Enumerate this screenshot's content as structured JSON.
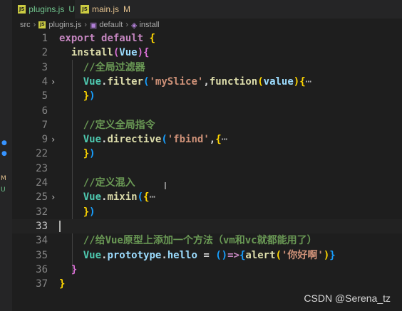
{
  "tabs": [
    {
      "name": "plugins.js",
      "status": "U",
      "active": true
    },
    {
      "name": "main.js",
      "status": "M",
      "active": false
    }
  ],
  "breadcrumb": {
    "folder": "src",
    "file": "plugins.js",
    "symbol1": "default",
    "symbol2": "install"
  },
  "activity_marks": {
    "m": "M",
    "u": "U"
  },
  "lines": [
    {
      "num": "1",
      "fold": "",
      "tokens": [
        {
          "t": "export ",
          "c": "kw"
        },
        {
          "t": "default ",
          "c": "kw"
        },
        {
          "t": "{",
          "c": "br1"
        }
      ]
    },
    {
      "num": "2",
      "fold": "",
      "tokens": [
        {
          "t": "  install",
          "c": "fn"
        },
        {
          "t": "(",
          "c": "br2"
        },
        {
          "t": "Vue",
          "c": "prop"
        },
        {
          "t": ")",
          "c": "br2"
        },
        {
          "t": "{",
          "c": "br2"
        }
      ]
    },
    {
      "num": "3",
      "fold": "",
      "tokens": [
        {
          "t": "    //全局过滤器",
          "c": "cm"
        }
      ]
    },
    {
      "num": "4",
      "fold": "›",
      "tokens": [
        {
          "t": "    Vue",
          "c": "cls"
        },
        {
          "t": ".",
          "c": "par"
        },
        {
          "t": "filter",
          "c": "fn"
        },
        {
          "t": "(",
          "c": "br3"
        },
        {
          "t": "'mySlice'",
          "c": "str"
        },
        {
          "t": ",",
          "c": "par"
        },
        {
          "t": "function",
          "c": "fn"
        },
        {
          "t": "(",
          "c": "br1"
        },
        {
          "t": "value",
          "c": "prop"
        },
        {
          "t": ")",
          "c": "br1"
        },
        {
          "t": "{",
          "c": "br1"
        },
        {
          "t": "⋯",
          "c": "ell"
        }
      ]
    },
    {
      "num": "5",
      "fold": "",
      "tokens": [
        {
          "t": "    }",
          "c": "br1"
        },
        {
          "t": ")",
          "c": "br3"
        }
      ]
    },
    {
      "num": "6",
      "fold": "",
      "tokens": []
    },
    {
      "num": "7",
      "fold": "",
      "tokens": [
        {
          "t": "    //定义全局指令",
          "c": "cm"
        }
      ]
    },
    {
      "num": "9",
      "fold": "›",
      "tokens": [
        {
          "t": "    Vue",
          "c": "cls"
        },
        {
          "t": ".",
          "c": "par"
        },
        {
          "t": "directive",
          "c": "fn"
        },
        {
          "t": "(",
          "c": "br3"
        },
        {
          "t": "'fbind'",
          "c": "str"
        },
        {
          "t": ",",
          "c": "par"
        },
        {
          "t": "{",
          "c": "br1"
        },
        {
          "t": "⋯",
          "c": "ell"
        }
      ]
    },
    {
      "num": "22",
      "fold": "",
      "tokens": [
        {
          "t": "    }",
          "c": "br1"
        },
        {
          "t": ")",
          "c": "br3"
        }
      ]
    },
    {
      "num": "23",
      "fold": "",
      "tokens": []
    },
    {
      "num": "24",
      "fold": "",
      "tokens": [
        {
          "t": "    //定义混入",
          "c": "cm"
        }
      ]
    },
    {
      "num": "25",
      "fold": "›",
      "tokens": [
        {
          "t": "    Vue",
          "c": "cls"
        },
        {
          "t": ".",
          "c": "par"
        },
        {
          "t": "mixin",
          "c": "fn"
        },
        {
          "t": "(",
          "c": "br3"
        },
        {
          "t": "{",
          "c": "br1"
        },
        {
          "t": "⋯",
          "c": "ell"
        }
      ]
    },
    {
      "num": "32",
      "fold": "",
      "tokens": [
        {
          "t": "    }",
          "c": "br1"
        },
        {
          "t": ")",
          "c": "br3"
        }
      ]
    },
    {
      "num": "33",
      "fold": "",
      "current": true,
      "tokens": []
    },
    {
      "num": "34",
      "fold": "",
      "tokens": [
        {
          "t": "    //给Vue原型上添加一个方法（vm和vc就都能用了）",
          "c": "cm"
        }
      ]
    },
    {
      "num": "35",
      "fold": "",
      "tokens": [
        {
          "t": "    Vue",
          "c": "cls"
        },
        {
          "t": ".",
          "c": "par"
        },
        {
          "t": "prototype",
          "c": "prop"
        },
        {
          "t": ".",
          "c": "par"
        },
        {
          "t": "hello",
          "c": "prop"
        },
        {
          "t": " = ",
          "c": "par"
        },
        {
          "t": "(",
          "c": "br3"
        },
        {
          "t": ")",
          "c": "br3"
        },
        {
          "t": "=>",
          "c": "kw"
        },
        {
          "t": "{",
          "c": "br3"
        },
        {
          "t": "alert",
          "c": "fn"
        },
        {
          "t": "(",
          "c": "br1"
        },
        {
          "t": "'你好啊'",
          "c": "str"
        },
        {
          "t": ")",
          "c": "br1"
        },
        {
          "t": "}",
          "c": "br3"
        }
      ]
    },
    {
      "num": "36",
      "fold": "",
      "tokens": [
        {
          "t": "  }",
          "c": "br2"
        }
      ]
    },
    {
      "num": "37",
      "fold": "",
      "tokens": [
        {
          "t": "}",
          "c": "br1"
        }
      ]
    }
  ],
  "watermark": "CSDN @Serena_tz",
  "colors": {
    "background": "#1e1e1e",
    "keyword": "#c586c0",
    "function": "#dcdcaa",
    "class": "#4ec9b0",
    "string": "#ce9178",
    "comment": "#6a9955",
    "variable": "#9cdcfe"
  }
}
